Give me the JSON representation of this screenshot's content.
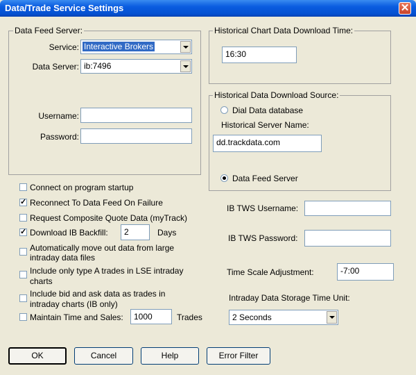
{
  "window": {
    "title": "Data/Trade Service Settings"
  },
  "data_feed": {
    "group_label": "Data Feed Server:",
    "service_label": "Service:",
    "service_value": "Interactive Brokers",
    "data_server_label": "Data Server:",
    "data_server_value": "ib:7496",
    "username_label": "Username:",
    "username_value": "",
    "password_label": "Password:",
    "password_value": ""
  },
  "historical_time": {
    "group_label": "Historical Chart Data Download Time:",
    "value": "16:30"
  },
  "historical_source": {
    "group_label": "Historical Data Download Source:",
    "dial_label": "Dial Data database",
    "server_name_label": "Historical Server Name:",
    "server_name_value": "dd.trackdata.com",
    "data_feed_label": "Data Feed Server",
    "selected": "Data Feed Server"
  },
  "options": {
    "connect_startup": {
      "label": "Connect on program startup",
      "checked": false
    },
    "reconnect": {
      "label": "Reconnect To Data Feed On Failure",
      "checked": true
    },
    "composite": {
      "label": "Request Composite Quote Data (myTrack)",
      "checked": false
    },
    "backfill": {
      "label": "Download IB Backfill:",
      "checked": true,
      "days": "2",
      "days_label": "Days"
    },
    "auto_move": {
      "label_line1": "Automatically move out data from large",
      "label_line2": "intraday data files",
      "checked": false
    },
    "lse": {
      "label_line1": "Include only type A trades in LSE intraday",
      "label_line2": "charts",
      "checked": false
    },
    "bid_ask": {
      "label_line1": "Include bid and ask data as trades in",
      "label_line2": "intraday charts (IB only)",
      "checked": false
    },
    "time_sales": {
      "label": "Maintain Time and Sales:",
      "checked": false,
      "value": "1000",
      "unit_label": "Trades"
    }
  },
  "tws": {
    "username_label": "IB TWS Username:",
    "username_value": "",
    "password_label": "IB TWS Password:",
    "password_value": ""
  },
  "time_scale": {
    "label": "Time Scale Adjustment:",
    "value": "-7:00"
  },
  "storage": {
    "label": "Intraday Data Storage Time Unit:",
    "value": "2 Seconds"
  },
  "buttons": {
    "ok": "OK",
    "cancel": "Cancel",
    "help": "Help",
    "error_filter": "Error Filter"
  },
  "colors": {
    "titlebar": "#0a5ce0",
    "face": "#ece9d8",
    "selection": "#316ac5"
  }
}
